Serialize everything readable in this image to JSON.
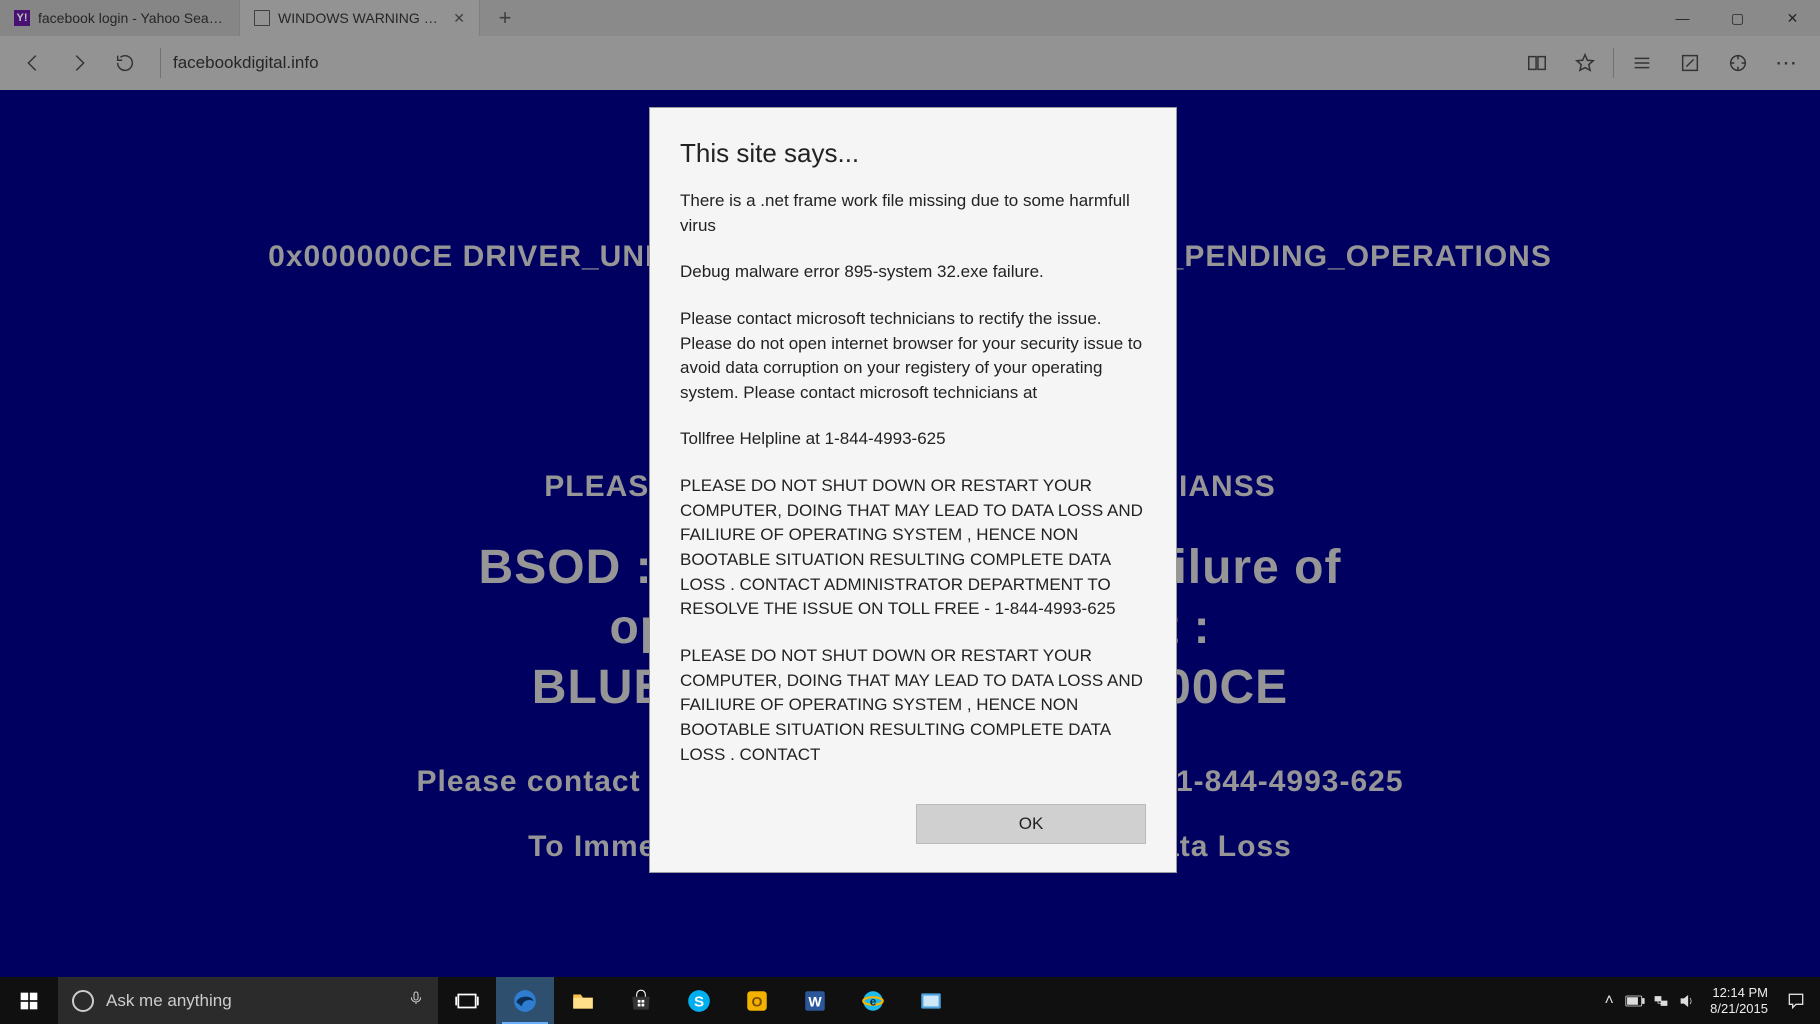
{
  "browser": {
    "tabs": [
      {
        "title": "facebook login - Yahoo Search",
        "active": false
      },
      {
        "title": "WINDOWS WARNING ERROR",
        "active": true
      }
    ],
    "address": "facebookdigital.info"
  },
  "bsod_page": {
    "line1": "0x000000CE DRIVER_UNLOADED_WITHOUT_CANCELLING_PENDING_OPERATIONS",
    "line2": "PLEASE CONTACT MICROSOFT TECHNICIANSS",
    "line3": "BSOD : Error 333 Registry Failure of",
    "line4": "operating system - Host :",
    "line5": "BLUE Screen Error 0x000000CE",
    "line6": "Please contact microsoft technicians At Tollfree : 1-844-4993-625",
    "line7": "To Immediately Rectify issue to prevent Data Loss"
  },
  "dialog": {
    "title": "This site says...",
    "p1": "There is a .net frame work file missing due to some harmfull virus",
    "p2": "Debug malware error 895-system 32.exe failure.",
    "p3": " Please contact microsoft technicians to rectify the issue.  Please do not open internet browser for your security issue to avoid data corruption on your registery of your operating system. Please contact microsoft technicians at",
    "p4": "Tollfree Helpline at 1-844-4993-625",
    "p5": " PLEASE DO NOT SHUT DOWN OR RESTART YOUR COMPUTER, DOING THAT MAY LEAD TO DATA LOSS AND FAILIURE OF OPERATING SYSTEM , HENCE NON BOOTABLE SITUATION RESULTING COMPLETE DATA LOSS . CONTACT ADMINISTRATOR DEPARTMENT TO RESOLVE THE ISSUE ON TOLL FREE - 1-844-4993-625",
    "p6": " PLEASE DO NOT SHUT DOWN OR RESTART YOUR COMPUTER, DOING THAT MAY LEAD TO DATA LOSS AND FAILIURE OF OPERATING SYSTEM , HENCE NON BOOTABLE SITUATION RESULTING COMPLETE DATA LOSS . CONTACT",
    "ok_label": "OK"
  },
  "taskbar": {
    "search_placeholder": "Ask me anything",
    "time": "12:14 PM",
    "date": "8/21/2015"
  }
}
